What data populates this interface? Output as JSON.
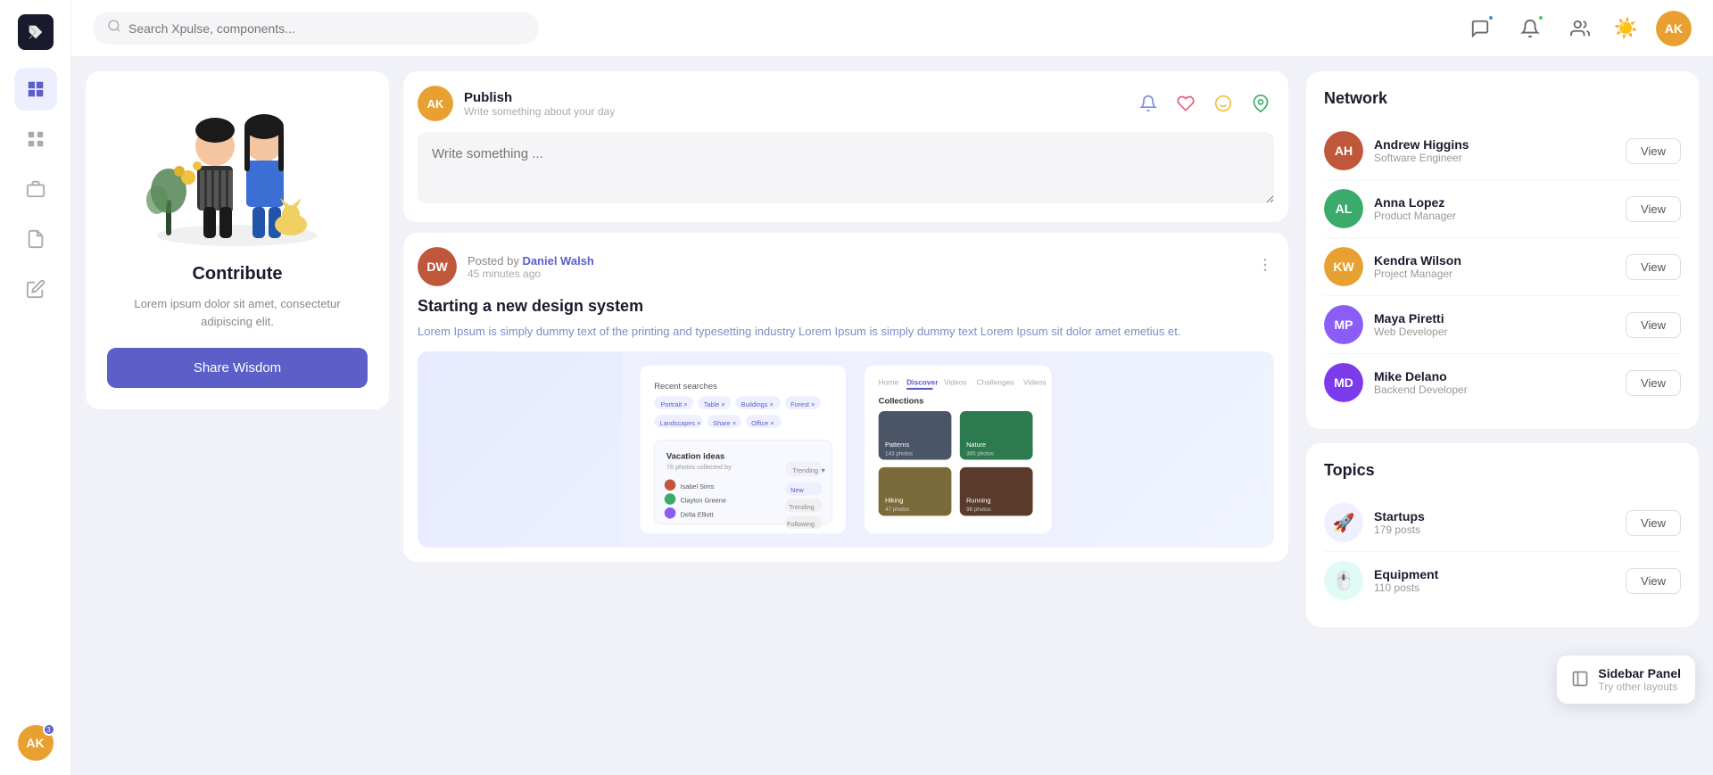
{
  "app": {
    "name": "Xpulse",
    "search_placeholder": "Search Xpulse, components..."
  },
  "sidebar": {
    "items": [
      {
        "id": "dashboard",
        "icon": "dashboard",
        "active": true
      },
      {
        "id": "grid",
        "icon": "grid"
      },
      {
        "id": "briefcase",
        "icon": "briefcase"
      },
      {
        "id": "file",
        "icon": "file"
      },
      {
        "id": "note",
        "icon": "note"
      }
    ],
    "user": {
      "initials": "AK",
      "color": "#e8a030",
      "notification_count": "3"
    }
  },
  "topnav": {
    "notification_dot_color": "#4a90d9",
    "bell_dot_color": "#4cca5a",
    "user_avatar_color": "#e8a030",
    "user_initials": "AK"
  },
  "contribute_card": {
    "title": "Contribute",
    "description": "Lorem ipsum dolor sit amet, consectetur adipiscing elit.",
    "button_label": "Share Wisdom"
  },
  "composer": {
    "user_name": "Publish",
    "user_sub": "Write something about your day",
    "placeholder": "Write something ...",
    "user_color": "#e8a030",
    "user_initials": "AK"
  },
  "posts": [
    {
      "posted_by_label": "Posted by",
      "author": "Daniel Walsh",
      "time_ago": "45 minutes ago",
      "author_color": "#c0573a",
      "author_initials": "DW",
      "title": "Starting a new design system",
      "excerpt": "Lorem Ipsum is simply dummy text of the printing and typesetting industry Lorem Ipsum is simply dummy text Lorem Ipsum sit dolor amet emetius et."
    }
  ],
  "network": {
    "title": "Network",
    "items": [
      {
        "name": "Andrew Higgins",
        "role": "Software Engineer",
        "color": "#c0573a",
        "initials": "AH"
      },
      {
        "name": "Anna Lopez",
        "role": "Product Manager",
        "color": "#3aab6b",
        "initials": "AL"
      },
      {
        "name": "Kendra Wilson",
        "role": "Project Manager",
        "color": "#e8a030",
        "initials": "KW"
      },
      {
        "name": "Maya Piretti",
        "role": "Web Developer",
        "color": "#8b5cf6",
        "initials": "MP"
      },
      {
        "name": "Mike Delano",
        "role": "Backend Developer",
        "color": "#7c3aed",
        "initials": "MD"
      }
    ],
    "view_label": "View"
  },
  "topics": {
    "title": "Topics",
    "items": [
      {
        "name": "Startups",
        "posts": "179 posts",
        "icon": "🚀",
        "icon_bg": "#eef0ff"
      },
      {
        "name": "Equipment",
        "posts": "110 posts",
        "icon": "🖱️",
        "icon_bg": "#e0faf5"
      }
    ],
    "view_label": "View"
  },
  "sidebar_panel": {
    "title": "Sidebar Panel",
    "subtitle": "Try other layouts"
  }
}
